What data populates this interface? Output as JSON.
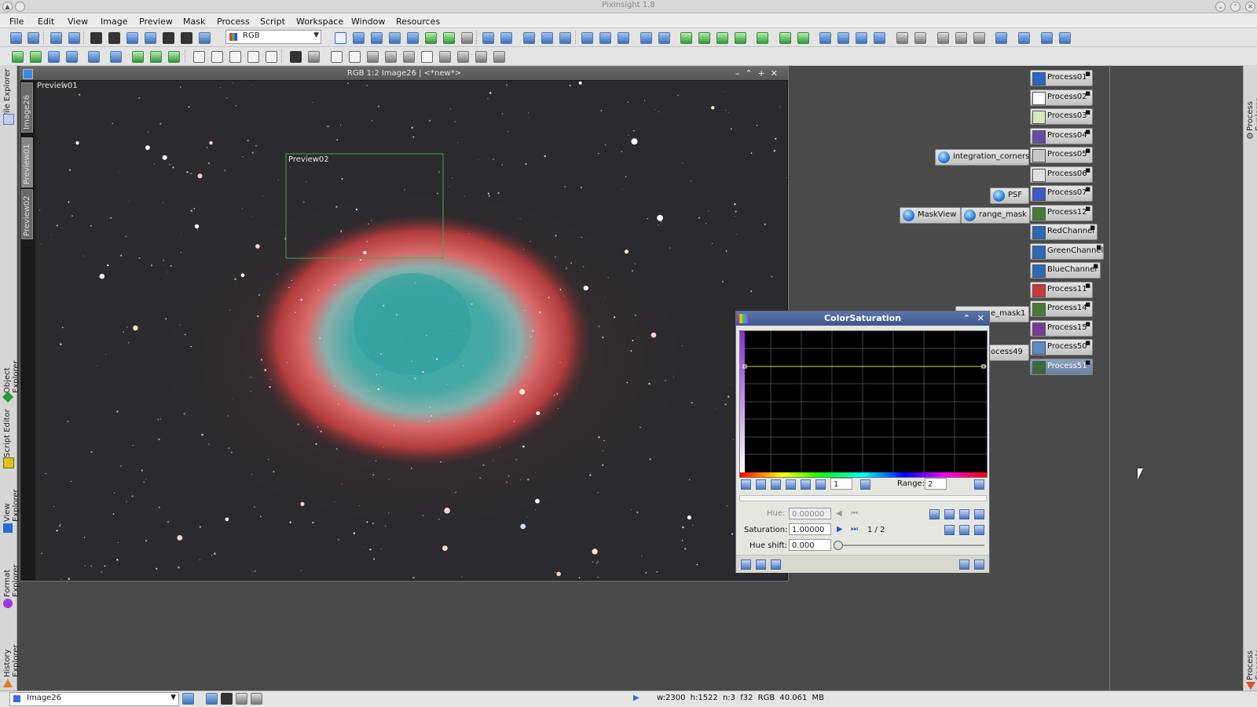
{
  "window": {
    "title": "PixInsight 1.8"
  },
  "menu": [
    "File",
    "Edit",
    "View",
    "Image",
    "Preview",
    "Mask",
    "Process",
    "Script",
    "Workspace",
    "Window",
    "Resources"
  ],
  "toolbar": {
    "color_mode": "RGB"
  },
  "left_tabs": {
    "file_explorer": "File Explorer",
    "object_explorer": "Object Explorer",
    "script_editor": "Script Editor",
    "view_explorer": "View Explorer",
    "format_explorer": "Format Explorer",
    "history_explorer": "History Explorer"
  },
  "right_tabs": {
    "process_explorer": "Process Explorer",
    "process_console": "Process Console"
  },
  "image_window": {
    "title": "RGB 1:2 Image26 | <*new*>",
    "side_tabs": [
      "Image26",
      "Preview01",
      "Preview02"
    ],
    "preview01_label": "Preview01",
    "preview02_label": "Preview02"
  },
  "process_icons": [
    {
      "label": "Process01",
      "color": "#2a64c8"
    },
    {
      "label": "Process02",
      "color": "#ffffff"
    },
    {
      "label": "Process03",
      "color": "#d8e8c0"
    },
    {
      "label": "Process04",
      "color": "#6a4aa8"
    },
    {
      "label": "Process05",
      "color": "#c8c8c8"
    },
    {
      "label": "Process06",
      "color": "#e0e0e0"
    },
    {
      "label": "Process07",
      "color": "#3a5ac8"
    },
    {
      "label": "Process12",
      "color": "#4a7a3a"
    },
    {
      "label": "RedChannel",
      "color": "#2a6ab8"
    },
    {
      "label": "GreenChannel",
      "color": "#2a6ab8"
    },
    {
      "label": "BlueChannel",
      "color": "#2a6ab8"
    },
    {
      "label": "Process11",
      "color": "#c83a3a"
    },
    {
      "label": "Process14",
      "color": "#4a7a3a"
    },
    {
      "label": "Process15",
      "color": "#7a3a9a"
    },
    {
      "label": "Process50",
      "color": "#5a8ac8"
    },
    {
      "label": "Process51",
      "color": "#3a6a3a"
    }
  ],
  "script_icons": {
    "integration_corners": "integration_corners",
    "psf": "PSF",
    "maskview": "MaskView",
    "range_mask": "range_mask",
    "partial_mask": "e_mask1",
    "partial_process": "ocess49"
  },
  "dialog": {
    "title": "ColorSaturation",
    "point_index": "1",
    "range_label": "Range:",
    "range_value": "2",
    "hue_label": "Hue:",
    "hue_value": "0.00000",
    "saturation_label": "Saturation:",
    "saturation_value": "1.00000",
    "point_count": "1 / 2",
    "hue_shift_label": "Hue shift:",
    "hue_shift_value": "0.000"
  },
  "statusbar": {
    "view": "Image26",
    "info": "w:2300  h:1522  n:3  f32  RGB  40.061 MB"
  }
}
